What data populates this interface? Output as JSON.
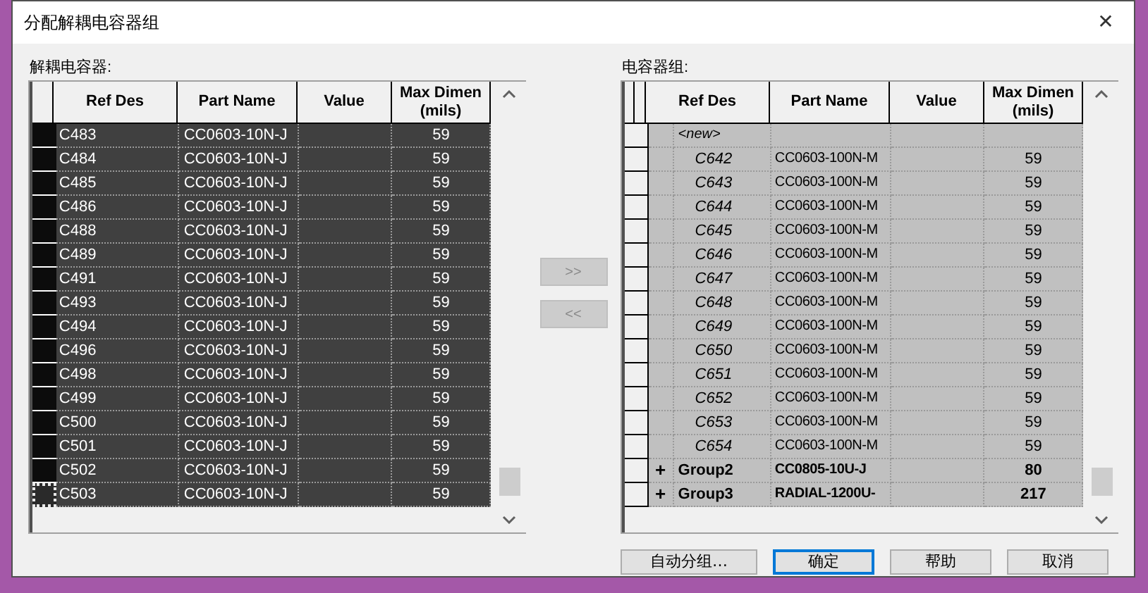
{
  "window": {
    "title": "分配解耦电容器组",
    "close": "✕"
  },
  "left": {
    "label": "解耦电容器:",
    "columns": [
      "Ref Des",
      "Part Name",
      "Value",
      "Max Dimen\n(mils)"
    ],
    "rows": [
      {
        "ref": "C483",
        "part": "CC0603-10N-J",
        "dim": "59",
        "selected": true,
        "focused": false
      },
      {
        "ref": "C484",
        "part": "CC0603-10N-J",
        "dim": "59",
        "selected": true,
        "focused": false
      },
      {
        "ref": "C485",
        "part": "CC0603-10N-J",
        "dim": "59",
        "selected": true,
        "focused": false
      },
      {
        "ref": "C486",
        "part": "CC0603-10N-J",
        "dim": "59",
        "selected": true,
        "focused": false
      },
      {
        "ref": "C488",
        "part": "CC0603-10N-J",
        "dim": "59",
        "selected": true,
        "focused": false
      },
      {
        "ref": "C489",
        "part": "CC0603-10N-J",
        "dim": "59",
        "selected": true,
        "focused": false
      },
      {
        "ref": "C491",
        "part": "CC0603-10N-J",
        "dim": "59",
        "selected": true,
        "focused": false
      },
      {
        "ref": "C493",
        "part": "CC0603-10N-J",
        "dim": "59",
        "selected": true,
        "focused": false
      },
      {
        "ref": "C494",
        "part": "CC0603-10N-J",
        "dim": "59",
        "selected": true,
        "focused": false
      },
      {
        "ref": "C496",
        "part": "CC0603-10N-J",
        "dim": "59",
        "selected": true,
        "focused": false
      },
      {
        "ref": "C498",
        "part": "CC0603-10N-J",
        "dim": "59",
        "selected": true,
        "focused": false
      },
      {
        "ref": "C499",
        "part": "CC0603-10N-J",
        "dim": "59",
        "selected": true,
        "focused": false
      },
      {
        "ref": "C500",
        "part": "CC0603-10N-J",
        "dim": "59",
        "selected": true,
        "focused": false
      },
      {
        "ref": "C501",
        "part": "CC0603-10N-J",
        "dim": "59",
        "selected": true,
        "focused": false
      },
      {
        "ref": "C502",
        "part": "CC0603-10N-J",
        "dim": "59",
        "selected": true,
        "focused": false
      },
      {
        "ref": "C503",
        "part": "CC0603-10N-J",
        "dim": "59",
        "selected": true,
        "focused": true
      }
    ]
  },
  "move_buttons": [
    {
      "label": ">>",
      "disabled": true
    },
    {
      "label": "<<",
      "disabled": true
    }
  ],
  "right": {
    "label": "电容器组:",
    "columns": [
      "Ref Des",
      "Part Name",
      "Value",
      "Max Dimen\n(mils)"
    ],
    "rows": [
      {
        "kind": "new",
        "ref": "<new>"
      },
      {
        "kind": "item",
        "ref": "C642",
        "part": "CC0603-100N-M",
        "dim": "59"
      },
      {
        "kind": "item",
        "ref": "C643",
        "part": "CC0603-100N-M",
        "dim": "59"
      },
      {
        "kind": "item",
        "ref": "C644",
        "part": "CC0603-100N-M",
        "dim": "59"
      },
      {
        "kind": "item",
        "ref": "C645",
        "part": "CC0603-100N-M",
        "dim": "59"
      },
      {
        "kind": "item",
        "ref": "C646",
        "part": "CC0603-100N-M",
        "dim": "59"
      },
      {
        "kind": "item",
        "ref": "C647",
        "part": "CC0603-100N-M",
        "dim": "59"
      },
      {
        "kind": "item",
        "ref": "C648",
        "part": "CC0603-100N-M",
        "dim": "59"
      },
      {
        "kind": "item",
        "ref": "C649",
        "part": "CC0603-100N-M",
        "dim": "59"
      },
      {
        "kind": "item",
        "ref": "C650",
        "part": "CC0603-100N-M",
        "dim": "59"
      },
      {
        "kind": "item",
        "ref": "C651",
        "part": "CC0603-100N-M",
        "dim": "59"
      },
      {
        "kind": "item",
        "ref": "C652",
        "part": "CC0603-100N-M",
        "dim": "59"
      },
      {
        "kind": "item",
        "ref": "C653",
        "part": "CC0603-100N-M",
        "dim": "59"
      },
      {
        "kind": "item",
        "ref": "C654",
        "part": "CC0603-100N-M",
        "dim": "59"
      },
      {
        "kind": "group",
        "expander": "+",
        "ref": "Group2",
        "part": "CC0805-10U-J",
        "dim": "80"
      },
      {
        "kind": "group",
        "expander": "+",
        "ref": "Group3",
        "part": "RADIAL-1200U-",
        "dim": "217"
      }
    ]
  },
  "buttons": [
    {
      "label": "自动分组…",
      "default": false
    },
    {
      "label": "确定",
      "default": true
    },
    {
      "label": "帮助",
      "default": false
    },
    {
      "label": "取消",
      "default": false
    }
  ]
}
